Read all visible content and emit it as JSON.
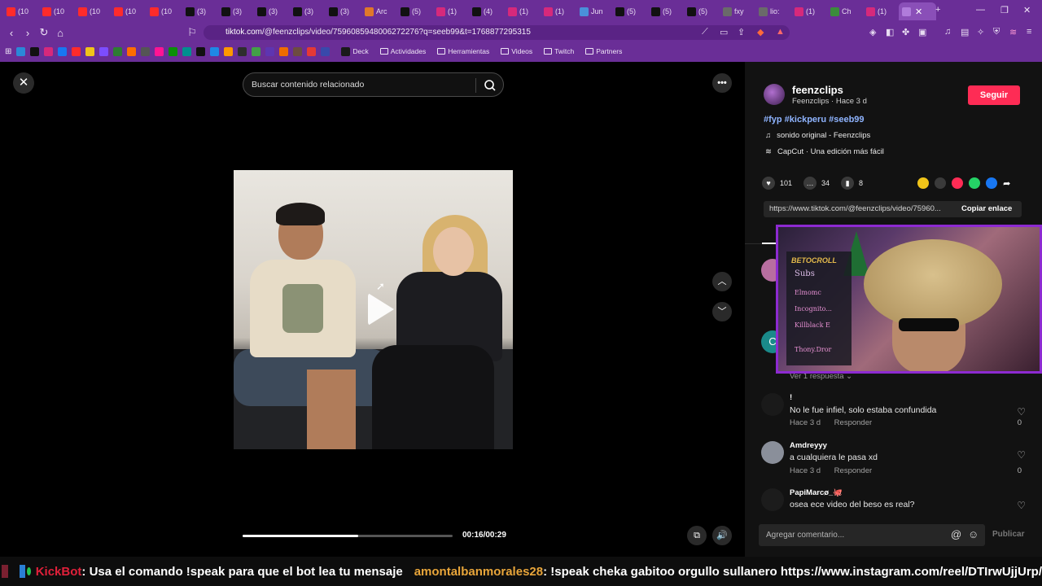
{
  "browser": {
    "tabs": [
      {
        "label": "(10",
        "icon": "youtube-icon",
        "color": "#ff2b2b"
      },
      {
        "label": "(10",
        "icon": "youtube-icon",
        "color": "#ff2b2b"
      },
      {
        "label": "(10",
        "icon": "youtube-icon",
        "color": "#ff2b2b"
      },
      {
        "label": "(10",
        "icon": "youtube-icon",
        "color": "#ff2b2b"
      },
      {
        "label": "(10",
        "icon": "youtube-icon",
        "color": "#ff2b2b"
      },
      {
        "label": "(3)",
        "icon": "x-icon",
        "color": "#111111"
      },
      {
        "label": "(3)",
        "icon": "x-icon",
        "color": "#111111"
      },
      {
        "label": "(3)",
        "icon": "x-icon",
        "color": "#111111"
      },
      {
        "label": "(3)",
        "icon": "x-icon",
        "color": "#111111"
      },
      {
        "label": "(3)",
        "icon": "x-icon",
        "color": "#111111"
      },
      {
        "label": "Arc",
        "icon": "arc-icon",
        "color": "#e0782a"
      },
      {
        "label": "(5)",
        "icon": "tiktok-icon",
        "color": "#111111"
      },
      {
        "label": "(1)",
        "icon": "instagram-icon",
        "color": "#d6297b"
      },
      {
        "label": "(4)",
        "icon": "tiktok-icon",
        "color": "#111111"
      },
      {
        "label": "(1)",
        "icon": "instagram-icon",
        "color": "#d6297b"
      },
      {
        "label": "(1)",
        "icon": "instagram-icon",
        "color": "#d6297b"
      },
      {
        "label": "Jun",
        "icon": "globe-icon",
        "color": "#4a90d9"
      },
      {
        "label": "(5)",
        "icon": "tiktok-icon",
        "color": "#111111"
      },
      {
        "label": "(5)",
        "icon": "tiktok-icon",
        "color": "#111111"
      },
      {
        "label": "(5)",
        "icon": "tiktok-icon",
        "color": "#111111"
      },
      {
        "label": "fxy",
        "icon": "globe-icon",
        "color": "#6a6a6a"
      },
      {
        "label": "lio:",
        "icon": "globe-icon",
        "color": "#6a6a6a"
      },
      {
        "label": "(1)",
        "icon": "instagram-icon",
        "color": "#d6297b"
      },
      {
        "label": "Ch",
        "icon": "chrome-icon",
        "color": "#3b8c3b"
      },
      {
        "label": "(1)",
        "icon": "instagram-icon",
        "color": "#d6297b"
      }
    ],
    "url_host": "tiktok.com",
    "url_path": "/@feenzclips/video/7596085948006272276?q=seeb99&t=1768877295315",
    "bookmarks": [
      {
        "label": "Deck"
      },
      {
        "label": "Actividades"
      },
      {
        "label": "Herramientas"
      },
      {
        "label": "Videos"
      },
      {
        "label": "Twitch"
      },
      {
        "label": "Partners"
      }
    ]
  },
  "viewer": {
    "search_placeholder": "Buscar contenido relacionado",
    "time_display": "00:16/00:29",
    "progress": 0.55
  },
  "post": {
    "username": "feenzclips",
    "subline": "Feenzclips · Hace 3 d",
    "follow_label": "Seguir",
    "hashtags": "#fyp #kickperu #seeb99",
    "sound": "sonido original - Feenzclips",
    "capcut": "CapCut · Una edición más fácil",
    "likes": "101",
    "comments_count": "34",
    "saves": "8",
    "link": "https://www.tiktok.com/@feenzclips/video/75960...",
    "copy_label": "Copiar enlace"
  },
  "stream_overlay": {
    "brand": "BETOCROLL",
    "subs_title": "Subs",
    "subs": [
      "Elmomc",
      "Incognito...",
      "Killblack E",
      "Thony.Dror"
    ]
  },
  "comments": {
    "replies_label": "Ver 1 respuesta ⌄",
    "items": [
      {
        "user": "!",
        "text": "No le fue infiel, solo estaba confundida",
        "time": "Hace 3 d",
        "reply": "Responder",
        "likes": "0"
      },
      {
        "user": "Amdreyyy",
        "text": "a cualquiera le pasa xd",
        "time": "Hace 3 d",
        "reply": "Responder",
        "likes": "0"
      },
      {
        "user": "PapiMarcø_🐙",
        "text": "osea ece video del beso es real?",
        "time": "",
        "reply": "",
        "likes": ""
      }
    ],
    "input_placeholder": "Agregar comentario...",
    "post_label": "Publicar"
  },
  "ticker": {
    "user1": "KickBot",
    "msg1": ": Usa el comando !speak para que el bot lea tu mensaje",
    "user2": "amontalbanmorales28",
    "msg2": ": !speak cheka gabitoo orgullo sullanero https://www.instagram.com/reel/DTIrwUjjUrp/"
  }
}
